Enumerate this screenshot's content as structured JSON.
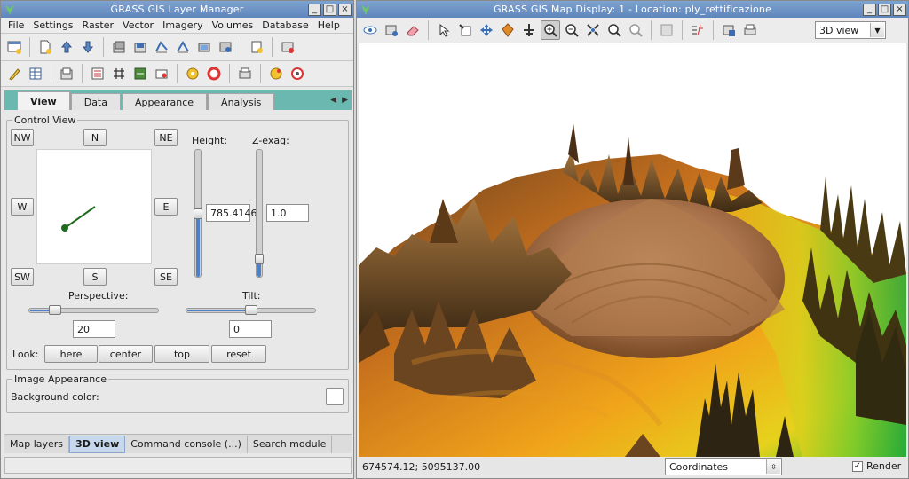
{
  "layer_manager": {
    "title": "GRASS GIS Layer Manager",
    "menu": [
      "File",
      "Settings",
      "Raster",
      "Vector",
      "Imagery",
      "Volumes",
      "Database",
      "Help"
    ],
    "tabs": [
      "View",
      "Data",
      "Appearance",
      "Analysis"
    ],
    "control_view": {
      "title": "Control View",
      "directions": {
        "nw": "NW",
        "n": "N",
        "ne": "NE",
        "w": "W",
        "e": "E",
        "sw": "SW",
        "s": "S",
        "se": "SE"
      },
      "height_label": "Height:",
      "height_value": "785.4146",
      "zexag_label": "Z-exag:",
      "zexag_value": "1.0",
      "perspective_label": "Perspective:",
      "perspective_value": "20",
      "tilt_label": "Tilt:",
      "tilt_value": "0",
      "look_label": "Look:",
      "look_buttons": [
        "here",
        "center",
        "top",
        "reset"
      ]
    },
    "image_appearance": {
      "title": "Image Appearance",
      "bg_label": "Background color:"
    },
    "bottom_tabs": [
      "Map layers",
      "3D view",
      "Command console (...)",
      "Search module"
    ]
  },
  "map_display": {
    "title": "GRASS GIS Map Display: 1  - Location: ply_rettificazione",
    "view_mode": "3D view",
    "coordinates": "674574.12; 5095137.00",
    "status_mode": "Coordinates",
    "render_label": "Render",
    "render_checked": true
  }
}
